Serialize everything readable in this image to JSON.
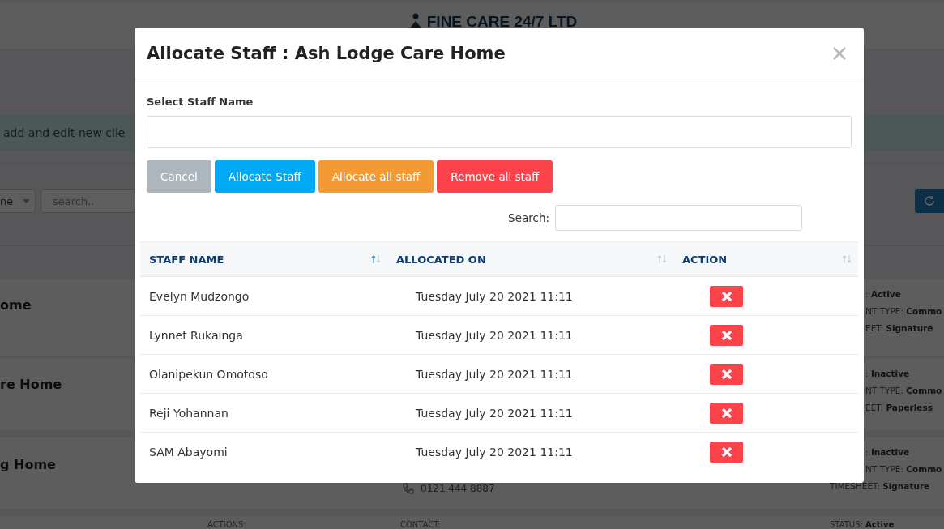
{
  "header": {
    "brand": "FINE CARE 24/7 LTD"
  },
  "page": {
    "notice": "add and edit new clie",
    "filter_select": "ne",
    "search": {
      "placeholder": "search.."
    },
    "cards": [
      {
        "name": "ome",
        "details": [
          ": **Active**",
          "NT TYPE: **Commo**",
          "EET: **Signature**"
        ]
      },
      {
        "name": "re Home",
        "details": [
          ": **Inactive**",
          "NT TYPE: **Commo**",
          "EET: **Paperless**"
        ]
      },
      {
        "name": "g Home",
        "phone": "0121 444 8887",
        "details": [
          ": **Inactive**",
          "NT TYPE: **Commo**"
        ],
        "timesheet": "TIMESHEET: **Signature**"
      }
    ],
    "footer_labels": [
      "ACTIONS:",
      "CONTACT:",
      "STATUS: **Active**"
    ]
  },
  "modal": {
    "title": "Allocate Staff : Ash Lodge Care Home",
    "field_label": "Select Staff Name",
    "buttons": [
      {
        "label": "Cancel",
        "kind": "secondary"
      },
      {
        "label": "Allocate Staff",
        "kind": "primary"
      },
      {
        "label": "Allocate all staff",
        "kind": "warning"
      },
      {
        "label": "Remove all staff",
        "kind": "danger"
      }
    ],
    "search_label": "Search:",
    "table": {
      "columns": [
        {
          "label": "STAFF NAME",
          "sorted": true
        },
        {
          "label": "ALLOCATED ON",
          "sorted": false
        },
        {
          "label": "ACTION",
          "sorted": false
        }
      ],
      "rows": [
        {
          "name": "Evelyn Mudzongo",
          "allocated_on": "Tuesday July 20 2021 11:11"
        },
        {
          "name": "Lynnet Rukainga",
          "allocated_on": "Tuesday July 20 2021 11:11"
        },
        {
          "name": "Olanipekun Omotoso",
          "allocated_on": "Tuesday July 20 2021 11:11"
        },
        {
          "name": "Reji Yohannan",
          "allocated_on": "Tuesday July 20 2021 11:11"
        },
        {
          "name": "SAM Abayomi",
          "allocated_on": "Tuesday July 20 2021 11:11"
        }
      ]
    }
  }
}
